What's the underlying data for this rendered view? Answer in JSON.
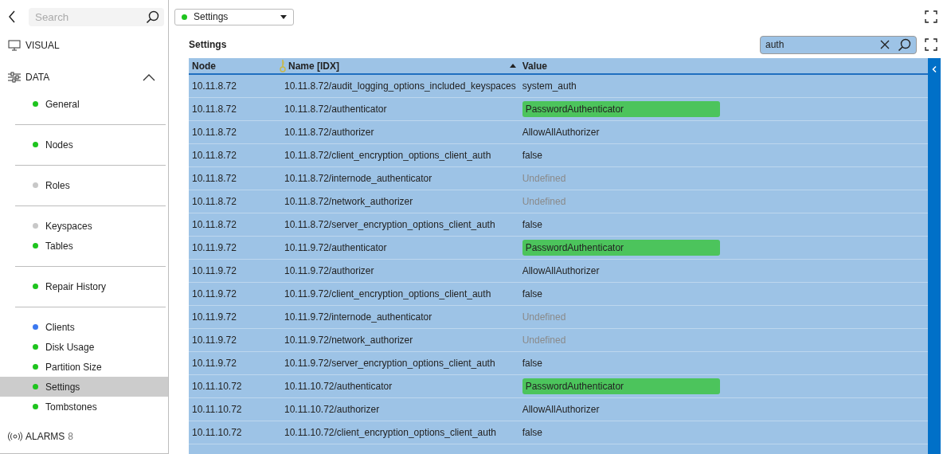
{
  "sidebar": {
    "search": {
      "placeholder": "Search"
    },
    "sections": [
      {
        "kind": "visual",
        "label": "VISUAL"
      },
      {
        "kind": "data",
        "label": "DATA",
        "expanded": true
      }
    ],
    "groups": [
      {
        "items": [
          {
            "label": "General",
            "color": "#1ec41e",
            "selected": false
          }
        ]
      },
      {
        "items": [
          {
            "label": "Nodes",
            "color": "#1ec41e",
            "selected": false
          }
        ]
      },
      {
        "items": [
          {
            "label": "Roles",
            "color": "#c8c8c8",
            "selected": false
          }
        ]
      },
      {
        "items": [
          {
            "label": "Keyspaces",
            "color": "#c8c8c8",
            "selected": false
          },
          {
            "label": "Tables",
            "color": "#1ec41e",
            "selected": false
          }
        ]
      },
      {
        "items": [
          {
            "label": "Repair History",
            "color": "#1ec41e",
            "selected": false
          }
        ]
      },
      {
        "items": [
          {
            "label": "Clients",
            "color": "#3b78f0",
            "selected": false
          },
          {
            "label": "Disk Usage",
            "color": "#1ec41e",
            "selected": false
          },
          {
            "label": "Partition Size",
            "color": "#1ec41e",
            "selected": false
          },
          {
            "label": "Settings",
            "color": "#1ec41e",
            "selected": true
          },
          {
            "label": "Tombstones",
            "color": "#1ec41e",
            "selected": false
          }
        ]
      }
    ],
    "alarms": {
      "label": "ALARMS",
      "count": "8"
    }
  },
  "dashboard_select": {
    "label": "Settings",
    "color": "#1ec41e"
  },
  "panel": {
    "title": "Settings",
    "filter": {
      "value": "auth"
    },
    "table": {
      "columns": [
        {
          "label": "Node",
          "key": false,
          "sorted": false
        },
        {
          "label": "Name [IDX]",
          "key": true,
          "sorted": true
        },
        {
          "label": "Value",
          "key": false,
          "sorted": false
        }
      ],
      "rows": [
        {
          "node": "10.11.8.72",
          "name": "10.11.8.72/audit_logging_options_included_keyspaces",
          "value": "system_auth",
          "kind": "plain"
        },
        {
          "node": "10.11.8.72",
          "name": "10.11.8.72/authenticator",
          "value": "PasswordAuthenticator",
          "kind": "highlight"
        },
        {
          "node": "10.11.8.72",
          "name": "10.11.8.72/authorizer",
          "value": "AllowAllAuthorizer",
          "kind": "plain"
        },
        {
          "node": "10.11.8.72",
          "name": "10.11.8.72/client_encryption_options_client_auth",
          "value": "false",
          "kind": "plain"
        },
        {
          "node": "10.11.8.72",
          "name": "10.11.8.72/internode_authenticator",
          "value": "Undefined",
          "kind": "undefined"
        },
        {
          "node": "10.11.8.72",
          "name": "10.11.8.72/network_authorizer",
          "value": "Undefined",
          "kind": "undefined"
        },
        {
          "node": "10.11.8.72",
          "name": "10.11.8.72/server_encryption_options_client_auth",
          "value": "false",
          "kind": "plain"
        },
        {
          "node": "10.11.9.72",
          "name": "10.11.9.72/authenticator",
          "value": "PasswordAuthenticator",
          "kind": "highlight"
        },
        {
          "node": "10.11.9.72",
          "name": "10.11.9.72/authorizer",
          "value": "AllowAllAuthorizer",
          "kind": "plain"
        },
        {
          "node": "10.11.9.72",
          "name": "10.11.9.72/client_encryption_options_client_auth",
          "value": "false",
          "kind": "plain"
        },
        {
          "node": "10.11.9.72",
          "name": "10.11.9.72/internode_authenticator",
          "value": "Undefined",
          "kind": "undefined"
        },
        {
          "node": "10.11.9.72",
          "name": "10.11.9.72/network_authorizer",
          "value": "Undefined",
          "kind": "undefined"
        },
        {
          "node": "10.11.9.72",
          "name": "10.11.9.72/server_encryption_options_client_auth",
          "value": "false",
          "kind": "plain"
        },
        {
          "node": "10.11.10.72",
          "name": "10.11.10.72/authenticator",
          "value": "PasswordAuthenticator",
          "kind": "highlight"
        },
        {
          "node": "10.11.10.72",
          "name": "10.11.10.72/authorizer",
          "value": "AllowAllAuthorizer",
          "kind": "plain"
        },
        {
          "node": "10.11.10.72",
          "name": "10.11.10.72/client_encryption_options_client_auth",
          "value": "false",
          "kind": "plain"
        }
      ]
    }
  }
}
